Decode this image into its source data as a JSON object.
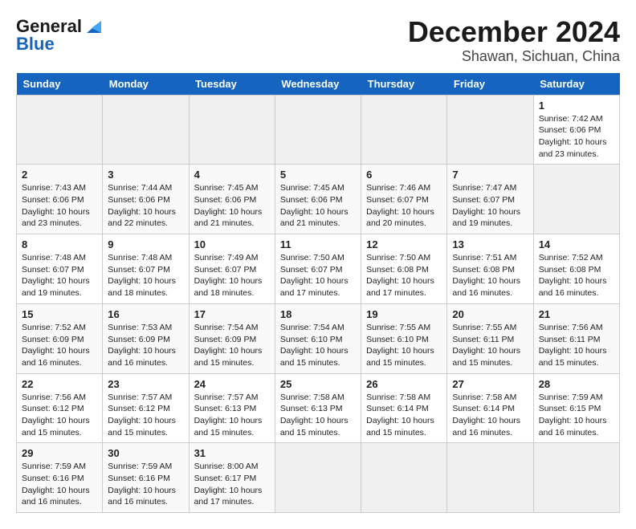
{
  "header": {
    "logo_line1": "General",
    "logo_line2": "Blue",
    "title": "December 2024",
    "subtitle": "Shawan, Sichuan, China"
  },
  "calendar": {
    "days_of_week": [
      "Sunday",
      "Monday",
      "Tuesday",
      "Wednesday",
      "Thursday",
      "Friday",
      "Saturday"
    ],
    "weeks": [
      [
        {
          "day": "",
          "info": ""
        },
        {
          "day": "",
          "info": ""
        },
        {
          "day": "",
          "info": ""
        },
        {
          "day": "",
          "info": ""
        },
        {
          "day": "",
          "info": ""
        },
        {
          "day": "",
          "info": ""
        },
        {
          "day": "1",
          "info": "Sunrise: 7:42 AM\nSunset: 6:06 PM\nDaylight: 10 hours\nand 23 minutes."
        }
      ],
      [
        {
          "day": "2",
          "info": "Sunrise: 7:43 AM\nSunset: 6:06 PM\nDaylight: 10 hours\nand 23 minutes."
        },
        {
          "day": "3",
          "info": "Sunrise: 7:44 AM\nSunset: 6:06 PM\nDaylight: 10 hours\nand 22 minutes."
        },
        {
          "day": "4",
          "info": "Sunrise: 7:45 AM\nSunset: 6:06 PM\nDaylight: 10 hours\nand 21 minutes."
        },
        {
          "day": "5",
          "info": "Sunrise: 7:45 AM\nSunset: 6:06 PM\nDaylight: 10 hours\nand 21 minutes."
        },
        {
          "day": "6",
          "info": "Sunrise: 7:46 AM\nSunset: 6:07 PM\nDaylight: 10 hours\nand 20 minutes."
        },
        {
          "day": "7",
          "info": "Sunrise: 7:47 AM\nSunset: 6:07 PM\nDaylight: 10 hours\nand 19 minutes."
        },
        {
          "day": "",
          "info": ""
        }
      ],
      [
        {
          "day": "8",
          "info": "Sunrise: 7:48 AM\nSunset: 6:07 PM\nDaylight: 10 hours\nand 19 minutes."
        },
        {
          "day": "9",
          "info": "Sunrise: 7:48 AM\nSunset: 6:07 PM\nDaylight: 10 hours\nand 18 minutes."
        },
        {
          "day": "10",
          "info": "Sunrise: 7:49 AM\nSunset: 6:07 PM\nDaylight: 10 hours\nand 18 minutes."
        },
        {
          "day": "11",
          "info": "Sunrise: 7:50 AM\nSunset: 6:07 PM\nDaylight: 10 hours\nand 17 minutes."
        },
        {
          "day": "12",
          "info": "Sunrise: 7:50 AM\nSunset: 6:08 PM\nDaylight: 10 hours\nand 17 minutes."
        },
        {
          "day": "13",
          "info": "Sunrise: 7:51 AM\nSunset: 6:08 PM\nDaylight: 10 hours\nand 16 minutes."
        },
        {
          "day": "14",
          "info": "Sunrise: 7:52 AM\nSunset: 6:08 PM\nDaylight: 10 hours\nand 16 minutes."
        }
      ],
      [
        {
          "day": "15",
          "info": "Sunrise: 7:52 AM\nSunset: 6:09 PM\nDaylight: 10 hours\nand 16 minutes."
        },
        {
          "day": "16",
          "info": "Sunrise: 7:53 AM\nSunset: 6:09 PM\nDaylight: 10 hours\nand 16 minutes."
        },
        {
          "day": "17",
          "info": "Sunrise: 7:54 AM\nSunset: 6:09 PM\nDaylight: 10 hours\nand 15 minutes."
        },
        {
          "day": "18",
          "info": "Sunrise: 7:54 AM\nSunset: 6:10 PM\nDaylight: 10 hours\nand 15 minutes."
        },
        {
          "day": "19",
          "info": "Sunrise: 7:55 AM\nSunset: 6:10 PM\nDaylight: 10 hours\nand 15 minutes."
        },
        {
          "day": "20",
          "info": "Sunrise: 7:55 AM\nSunset: 6:11 PM\nDaylight: 10 hours\nand 15 minutes."
        },
        {
          "day": "21",
          "info": "Sunrise: 7:56 AM\nSunset: 6:11 PM\nDaylight: 10 hours\nand 15 minutes."
        }
      ],
      [
        {
          "day": "22",
          "info": "Sunrise: 7:56 AM\nSunset: 6:12 PM\nDaylight: 10 hours\nand 15 minutes."
        },
        {
          "day": "23",
          "info": "Sunrise: 7:57 AM\nSunset: 6:12 PM\nDaylight: 10 hours\nand 15 minutes."
        },
        {
          "day": "24",
          "info": "Sunrise: 7:57 AM\nSunset: 6:13 PM\nDaylight: 10 hours\nand 15 minutes."
        },
        {
          "day": "25",
          "info": "Sunrise: 7:58 AM\nSunset: 6:13 PM\nDaylight: 10 hours\nand 15 minutes."
        },
        {
          "day": "26",
          "info": "Sunrise: 7:58 AM\nSunset: 6:14 PM\nDaylight: 10 hours\nand 15 minutes."
        },
        {
          "day": "27",
          "info": "Sunrise: 7:58 AM\nSunset: 6:14 PM\nDaylight: 10 hours\nand 16 minutes."
        },
        {
          "day": "28",
          "info": "Sunrise: 7:59 AM\nSunset: 6:15 PM\nDaylight: 10 hours\nand 16 minutes."
        }
      ],
      [
        {
          "day": "29",
          "info": "Sunrise: 7:59 AM\nSunset: 6:16 PM\nDaylight: 10 hours\nand 16 minutes."
        },
        {
          "day": "30",
          "info": "Sunrise: 7:59 AM\nSunset: 6:16 PM\nDaylight: 10 hours\nand 16 minutes."
        },
        {
          "day": "31",
          "info": "Sunrise: 8:00 AM\nSunset: 6:17 PM\nDaylight: 10 hours\nand 17 minutes."
        },
        {
          "day": "",
          "info": ""
        },
        {
          "day": "",
          "info": ""
        },
        {
          "day": "",
          "info": ""
        },
        {
          "day": "",
          "info": ""
        }
      ]
    ]
  }
}
